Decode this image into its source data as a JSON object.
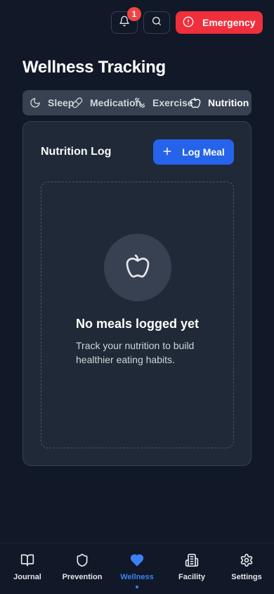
{
  "topbar": {
    "notification_count": "1",
    "emergency_label": "Emergency"
  },
  "page": {
    "title": "Wellness Tracking"
  },
  "tabs": [
    {
      "label": "Sleep",
      "icon": "moon-icon"
    },
    {
      "label": "Medication",
      "icon": "pill-icon"
    },
    {
      "label": "Exercise",
      "icon": "dumbbell-icon"
    },
    {
      "label": "Nutrition",
      "icon": "apple-icon",
      "active": true
    }
  ],
  "card": {
    "title": "Nutrition Log",
    "log_button": "Log Meal",
    "empty_title": "No meals logged yet",
    "empty_description": "Track your nutrition to build healthier eating habits."
  },
  "bottom_nav": [
    {
      "label": "Journal",
      "icon": "book-icon"
    },
    {
      "label": "Prevention",
      "icon": "shield-icon"
    },
    {
      "label": "Wellness",
      "icon": "heart-icon",
      "active": true
    },
    {
      "label": "Facility",
      "icon": "building-icon"
    },
    {
      "label": "Settings",
      "icon": "gear-icon"
    }
  ],
  "colors": {
    "background": "#111827",
    "card": "#1f2937",
    "accent": "#2563eb",
    "danger": "#ef2f3c"
  }
}
